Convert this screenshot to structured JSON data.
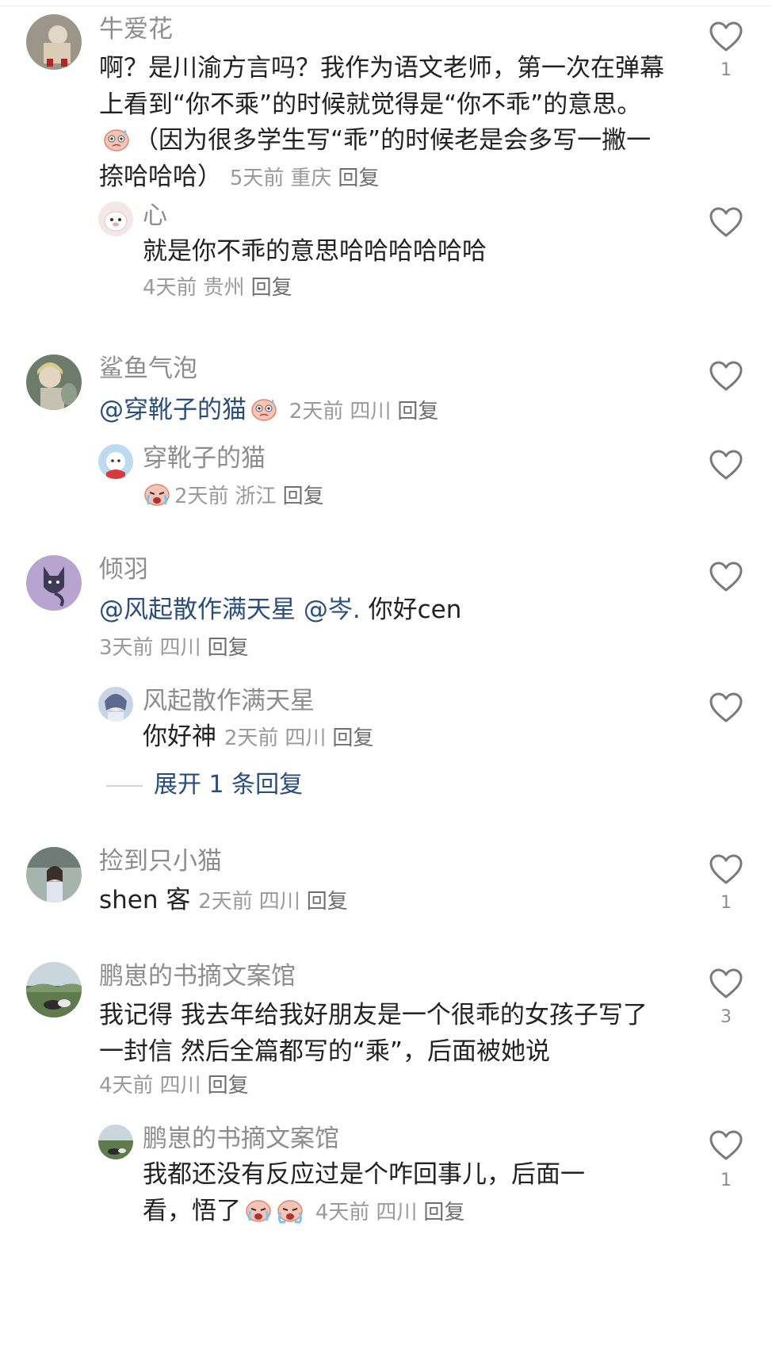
{
  "reply_label": "回复",
  "comments": [
    {
      "author": "牛爱花",
      "text": "啊？是川渝方言吗？我作为语文老师，第一次在弹幕上看到“你不乘”的时候就觉得是“你不乖”的意思。",
      "text2": "（因为很多学生写“乖”的时候老是会多写一撇一捺哈哈哈）",
      "time": "5天前",
      "location": "重庆",
      "likes": "1",
      "replies": [
        {
          "author": "心",
          "text": "就是你不乖的意思哈哈哈哈哈哈",
          "time": "4天前",
          "location": "贵州"
        }
      ]
    },
    {
      "author": "鲨鱼气泡",
      "mention": "@穿靴子的猫",
      "time": "2天前",
      "location": "四川",
      "replies": [
        {
          "author": "穿靴子的猫",
          "time": "2天前",
          "location": "浙江"
        }
      ]
    },
    {
      "author": "倾羽",
      "mention1": "@风起散作满天星",
      "mention2": "@岑.",
      "text": "你好cen",
      "time": "3天前",
      "location": "四川",
      "replies": [
        {
          "author": "风起散作满天星",
          "text": "你好神",
          "time": "2天前",
          "location": "四川"
        }
      ],
      "expand_label": "展开 1 条回复"
    },
    {
      "author": "捡到只小猫",
      "text": "shen 客",
      "time": "2天前",
      "location": "四川",
      "likes": "1"
    },
    {
      "author": "鹏崽的书摘文案馆",
      "text": "我记得 我去年给我好朋友是一个很乖的女孩子写了一封信 然后全篇都写的“乘”，后面被她说",
      "time": "4天前",
      "location": "四川",
      "likes": "3",
      "replies": [
        {
          "author": "鹏崽的书摘文案馆",
          "text": "我都还没有反应过是个咋回事儿，后面一看，悟了",
          "time": "4天前",
          "location": "四川",
          "likes": "1"
        }
      ]
    }
  ],
  "icons": {
    "like": "heart-outline-icon",
    "emoji_sweat": "sweat-face-emoji",
    "emoji_cry": "crying-face-emoji"
  },
  "colors": {
    "name": "#8d8d8d",
    "text": "#222222",
    "mention": "#2b4d7c",
    "meta": "#9a9a9a"
  }
}
